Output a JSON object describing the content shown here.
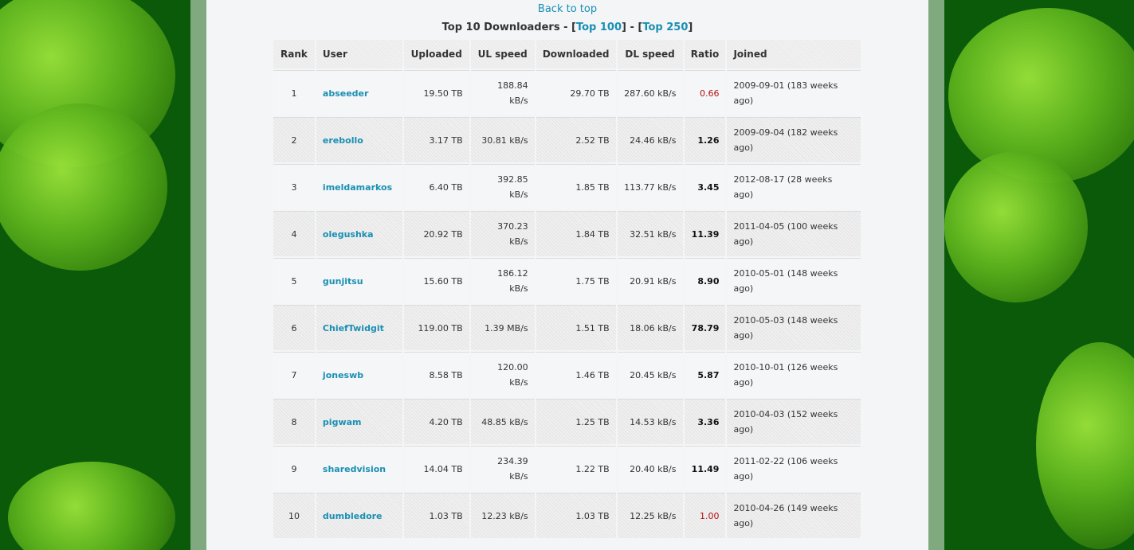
{
  "nav": {
    "back_to_top": "Back to top"
  },
  "header": {
    "prefix": "Top 10 Downloaders - [",
    "top100": "Top 100",
    "middle": "] - [",
    "top250": "Top 250",
    "suffix": "]"
  },
  "table": {
    "columns": [
      "Rank",
      "User",
      "Uploaded",
      "UL speed",
      "Downloaded",
      "DL speed",
      "Ratio",
      "Joined"
    ],
    "rows": [
      {
        "rank": "1",
        "user": "abseeder",
        "uploaded": "19.50 TB",
        "ul_speed": "188.84 kB/s",
        "downloaded": "29.70 TB",
        "dl_speed": "287.60 kB/s",
        "ratio": "0.66",
        "joined": "2009-09-01 (183 weeks ago)"
      },
      {
        "rank": "2",
        "user": "erebollo",
        "uploaded": "3.17 TB",
        "ul_speed": "30.81 kB/s",
        "downloaded": "2.52 TB",
        "dl_speed": "24.46 kB/s",
        "ratio": "1.26",
        "joined": "2009-09-04 (182 weeks ago)"
      },
      {
        "rank": "3",
        "user": "imeldamarkos",
        "uploaded": "6.40 TB",
        "ul_speed": "392.85 kB/s",
        "downloaded": "1.85 TB",
        "dl_speed": "113.77 kB/s",
        "ratio": "3.45",
        "joined": "2012-08-17 (28 weeks ago)"
      },
      {
        "rank": "4",
        "user": "olegushka",
        "uploaded": "20.92 TB",
        "ul_speed": "370.23 kB/s",
        "downloaded": "1.84 TB",
        "dl_speed": "32.51 kB/s",
        "ratio": "11.39",
        "joined": "2011-04-05 (100 weeks ago)"
      },
      {
        "rank": "5",
        "user": "gunjitsu",
        "uploaded": "15.60 TB",
        "ul_speed": "186.12 kB/s",
        "downloaded": "1.75 TB",
        "dl_speed": "20.91 kB/s",
        "ratio": "8.90",
        "joined": "2010-05-01 (148 weeks ago)"
      },
      {
        "rank": "6",
        "user": "ChiefTwidgit",
        "uploaded": "119.00 TB",
        "ul_speed": "1.39 MB/s",
        "downloaded": "1.51 TB",
        "dl_speed": "18.06 kB/s",
        "ratio": "78.79",
        "joined": "2010-05-03 (148 weeks ago)"
      },
      {
        "rank": "7",
        "user": "joneswb",
        "uploaded": "8.58 TB",
        "ul_speed": "120.00 kB/s",
        "downloaded": "1.46 TB",
        "dl_speed": "20.45 kB/s",
        "ratio": "5.87",
        "joined": "2010-10-01 (126 weeks ago)"
      },
      {
        "rank": "8",
        "user": "pigwam",
        "uploaded": "4.20 TB",
        "ul_speed": "48.85 kB/s",
        "downloaded": "1.25 TB",
        "dl_speed": "14.53 kB/s",
        "ratio": "3.36",
        "joined": "2010-04-03 (152 weeks ago)"
      },
      {
        "rank": "9",
        "user": "sharedvision",
        "uploaded": "14.04 TB",
        "ul_speed": "234.39 kB/s",
        "downloaded": "1.22 TB",
        "dl_speed": "20.40 kB/s",
        "ratio": "11.49",
        "joined": "2011-02-22 (106 weeks ago)"
      },
      {
        "rank": "10",
        "user": "dumbledore",
        "uploaded": "1.03 TB",
        "ul_speed": "12.23 kB/s",
        "downloaded": "1.03 TB",
        "dl_speed": "12.25 kB/s",
        "ratio": "1.00",
        "joined": "2010-04-26 (149 weeks ago)"
      }
    ]
  },
  "colors": {
    "link": "#1a8fb3",
    "ratio_low": "#b01010",
    "background": "#0a5a0a"
  },
  "background_icons": [
    "clover-icon"
  ]
}
